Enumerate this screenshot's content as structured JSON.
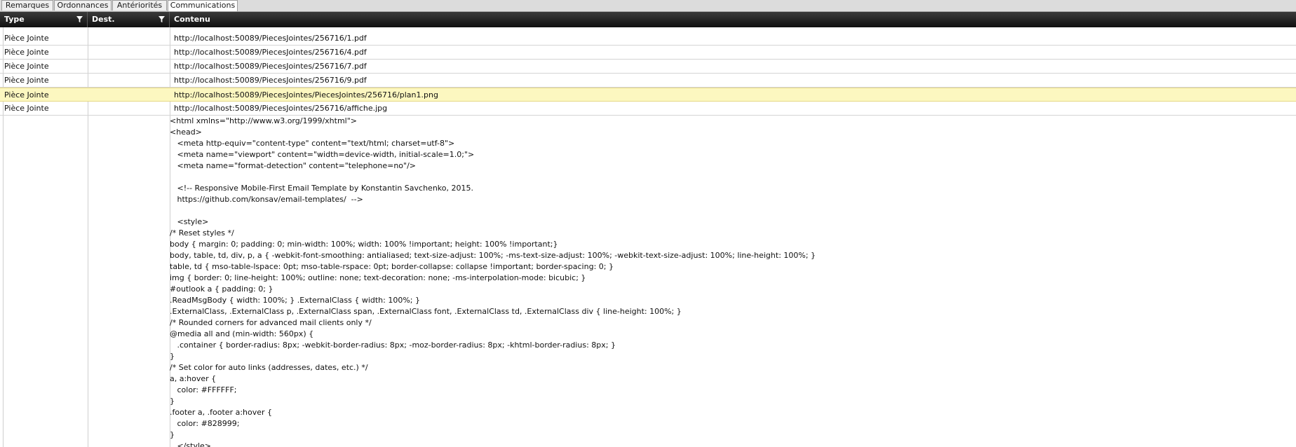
{
  "tabs": [
    {
      "label": "Remarques",
      "active": false
    },
    {
      "label": "Ordonnances",
      "active": false
    },
    {
      "label": "Antériorités",
      "active": false
    },
    {
      "label": "Communications",
      "active": true
    }
  ],
  "grid": {
    "columns": [
      {
        "label": "Type",
        "filter": true,
        "icon": "filter-icon"
      },
      {
        "label": "Dest.",
        "filter": true,
        "icon": "filter-icon"
      },
      {
        "label": "Contenu",
        "filter": false
      }
    ],
    "rows": [
      {
        "type": "Pièce Jointe",
        "dest": "",
        "content": "http://localhost:50089/PiecesJointes/256716/1.pdf",
        "selected": false
      },
      {
        "type": "Pièce Jointe",
        "dest": "",
        "content": "http://localhost:50089/PiecesJointes/256716/4.pdf",
        "selected": false
      },
      {
        "type": "Pièce Jointe",
        "dest": "",
        "content": "http://localhost:50089/PiecesJointes/256716/7.pdf",
        "selected": false
      },
      {
        "type": "Pièce Jointe",
        "dest": "",
        "content": "http://localhost:50089/PiecesJointes/256716/9.pdf",
        "selected": false
      },
      {
        "type": "Pièce Jointe",
        "dest": "",
        "content": "http://localhost:50089/PiecesJointes/PiecesJointes/256716/plan1.png",
        "selected": true
      },
      {
        "type": "Pièce Jointe",
        "dest": "",
        "content": "http://localhost:50089/PiecesJointes/256716/affiche.jpg",
        "selected": false
      }
    ],
    "html_content_lines": [
      "<html xmlns=\"http://www.w3.org/1999/xhtml\">",
      "<head>",
      "   <meta http-equiv=\"content-type\" content=\"text/html; charset=utf-8\">",
      "   <meta name=\"viewport\" content=\"width=device-width, initial-scale=1.0;\">",
      "   <meta name=\"format-detection\" content=\"telephone=no\"/>",
      "",
      "   <!-- Responsive Mobile-First Email Template by Konstantin Savchenko, 2015.",
      "   https://github.com/konsav/email-templates/  -->",
      "",
      "   <style>",
      "/* Reset styles */",
      "body { margin: 0; padding: 0; min-width: 100%; width: 100% !important; height: 100% !important;}",
      "body, table, td, div, p, a { -webkit-font-smoothing: antialiased; text-size-adjust: 100%; -ms-text-size-adjust: 100%; -webkit-text-size-adjust: 100%; line-height: 100%; }",
      "table, td { mso-table-lspace: 0pt; mso-table-rspace: 0pt; border-collapse: collapse !important; border-spacing: 0; }",
      "img { border: 0; line-height: 100%; outline: none; text-decoration: none; -ms-interpolation-mode: bicubic; }",
      "#outlook a { padding: 0; }",
      ".ReadMsgBody { width: 100%; } .ExternalClass { width: 100%; }",
      ".ExternalClass, .ExternalClass p, .ExternalClass span, .ExternalClass font, .ExternalClass td, .ExternalClass div { line-height: 100%; }",
      "/* Rounded corners for advanced mail clients only */",
      "@media all and (min-width: 560px) {",
      "   .container { border-radius: 8px; -webkit-border-radius: 8px; -moz-border-radius: 8px; -khtml-border-radius: 8px; }",
      "}",
      "/* Set color for auto links (addresses, dates, etc.) */",
      "a, a:hover {",
      "   color: #FFFFFF;",
      "}",
      ".footer a, .footer a:hover {",
      "   color: #828999;",
      "}",
      "   </style>"
    ]
  }
}
